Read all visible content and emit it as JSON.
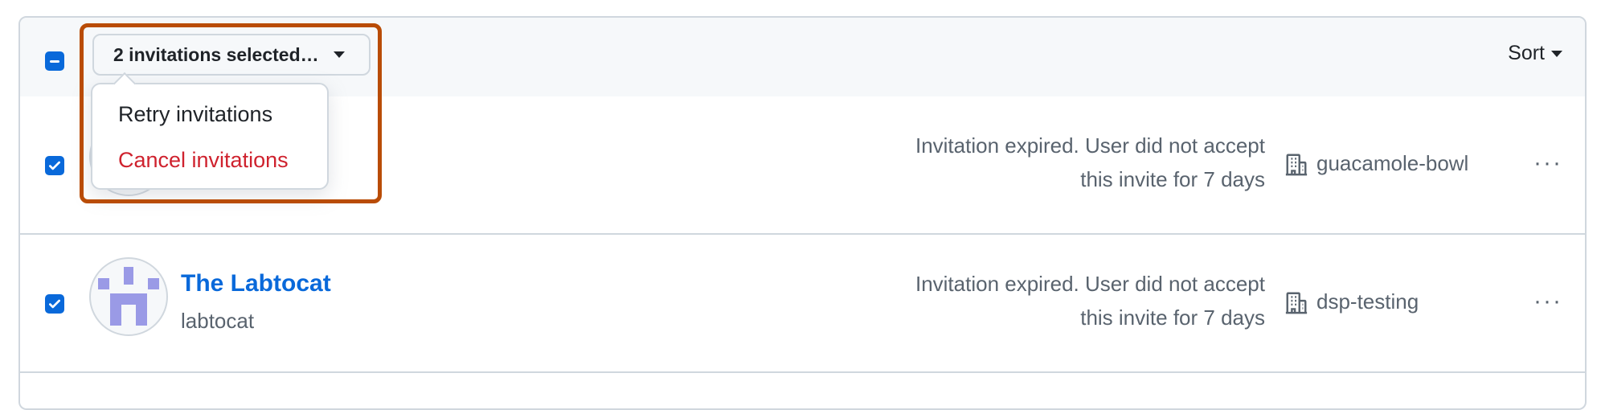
{
  "header": {
    "selection_label": "2 invitations selected…",
    "sort_label": "Sort"
  },
  "menu": {
    "retry_label": "Retry invitations",
    "cancel_label": "Cancel invitations"
  },
  "rows": [
    {
      "status_line1": "Invitation expired. User did not accept",
      "status_line2": "this invite for 7 days",
      "org": "guacamole-bowl",
      "more": "···"
    },
    {
      "name": "The Labtocat",
      "login": "labtocat",
      "status_line1": "Invitation expired. User did not accept",
      "status_line2": "this invite for 7 days",
      "org": "dsp-testing",
      "more": "···"
    }
  ],
  "colors": {
    "accent": "#0969da",
    "danger": "#cf222e",
    "highlight": "#b94c06",
    "avatar_identicon": "#9a9ae6"
  }
}
